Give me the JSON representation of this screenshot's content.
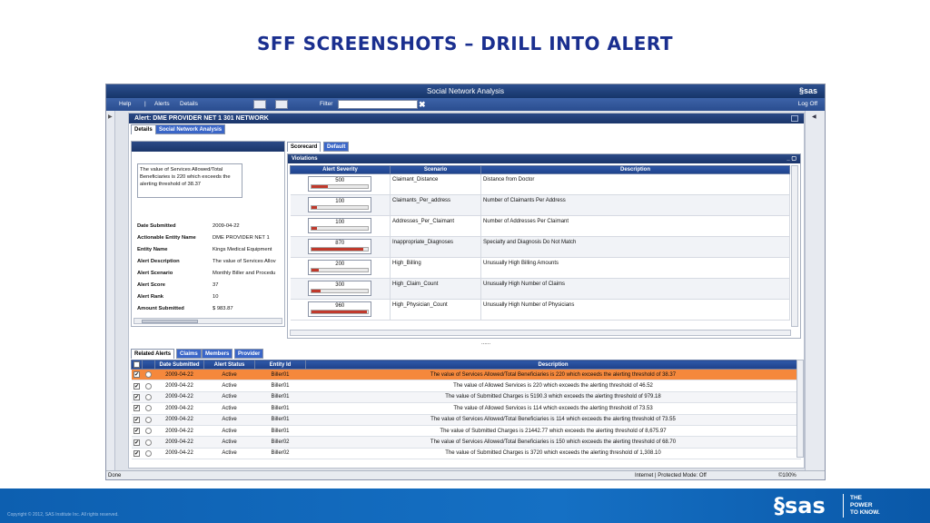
{
  "slide": {
    "title": "SFF SCREENSHOTS – DRILL INTO ALERT"
  },
  "window": {
    "title": "Social Network Analysis",
    "logo": "§sas"
  },
  "menu": {
    "help": "Help",
    "alerts": "Alerts",
    "details": "Details",
    "filter_label": "Filter",
    "filter_value": "",
    "clear": "✖",
    "logoff": "Log Off"
  },
  "alert": {
    "title": "Alert:  DME PROVIDER NET 1 301 NETWORK"
  },
  "tabs": [
    "Details",
    "Social Network Analysis"
  ],
  "details": {
    "description": "The value of Services Allowed/Total Beneficiaries is 220 which exceeds the alerting threshold of 38.37",
    "fields": [
      {
        "k": "Date Submitted",
        "v": "2009-04-22"
      },
      {
        "k": "Actionable Entity Name",
        "v": "DME PROVIDER NET 1"
      },
      {
        "k": "Entity Name",
        "v": "Kings Medical Equipment"
      },
      {
        "k": "Alert Description",
        "v": "The value of Services Allov"
      },
      {
        "k": "Alert Scenario",
        "v": "Monthly Biller and Procedu"
      },
      {
        "k": "Alert Score",
        "v": "37"
      },
      {
        "k": "Alert Rank",
        "v": "10"
      },
      {
        "k": "Amount Submitted",
        "v": "$ 983.87"
      }
    ]
  },
  "scorecard_tabs": [
    "Scorecard",
    "Default"
  ],
  "violations": {
    "title": "Violations",
    "columns": [
      "Alert Severity",
      "Scenario",
      "Description"
    ],
    "rows": [
      {
        "severity": "500",
        "fill": 0.28,
        "scenario": "Claimant_Distance",
        "description": "Distance from Doctor"
      },
      {
        "severity": "100",
        "fill": 0.1,
        "scenario": "Claimants_Per_address",
        "description": "Number of Claimants Per Address"
      },
      {
        "severity": "100",
        "fill": 0.1,
        "scenario": "Addresses_Per_Claimant",
        "description": "Number of Addresses Per Claimant"
      },
      {
        "severity": "870",
        "fill": 0.92,
        "scenario": "Inappropriate_Diagnoses",
        "description": "Specialty and Diagnosis Do Not Match"
      },
      {
        "severity": "200",
        "fill": 0.12,
        "scenario": "High_Billing",
        "description": "Unusually High Billing Amounts"
      },
      {
        "severity": "300",
        "fill": 0.16,
        "scenario": "High_Claim_Count",
        "description": "Unusually High Number of Claims"
      },
      {
        "severity": "960",
        "fill": 0.98,
        "scenario": "High_Physician_Count",
        "description": "Unusually High Number of Physicians"
      }
    ]
  },
  "related_tabs": [
    "Related Alerts",
    "Claims",
    "Members",
    "Provider"
  ],
  "related": {
    "columns": [
      "Date Submitted",
      "Alert Status",
      "Entity Id",
      "Description"
    ],
    "rows": [
      {
        "date": "2009-04-22",
        "status": "Active",
        "entity": "Biller01",
        "desc": "The value of Services Allowed/Total Beneficiaries is 220 which exceeds the alerting threshold of 38.37",
        "selected": true
      },
      {
        "date": "2009-04-22",
        "status": "Active",
        "entity": "Biller01",
        "desc": "The value of Allowed Services is 220 which exceeds the alerting threshold of 46.52",
        "selected": false
      },
      {
        "date": "2009-04-22",
        "status": "Active",
        "entity": "Biller01",
        "desc": "The value of Submitted Charges is 5190.3 which exceeds the alerting threshold of 979.18",
        "selected": false
      },
      {
        "date": "2009-04-22",
        "status": "Active",
        "entity": "Biller01",
        "desc": "The value of Allowed Services is 114 which exceeds the alerting threshold of 73.53",
        "selected": false
      },
      {
        "date": "2009-04-22",
        "status": "Active",
        "entity": "Biller01",
        "desc": "The value of Services Allowed/Total Beneficiaries is 114 which exceeds the alerting threshold of 73.55",
        "selected": false
      },
      {
        "date": "2009-04-22",
        "status": "Active",
        "entity": "Biller01",
        "desc": "The value of Submitted Charges is 21442.77 which exceeds the alerting threshold of 8,675.97",
        "selected": false
      },
      {
        "date": "2009-04-22",
        "status": "Active",
        "entity": "Biller02",
        "desc": "The value of Services Allowed/Total Beneficiaries is 150 which exceeds the alerting threshold of 68.70",
        "selected": false
      },
      {
        "date": "2009-04-22",
        "status": "Active",
        "entity": "Biller02",
        "desc": "The value of Submitted Charges is 3720 which exceeds the alerting threshold of 1,308.10",
        "selected": false
      }
    ]
  },
  "status": {
    "left": "Done",
    "zone": "Internet | Protected Mode: Off",
    "zoom": "©100%"
  },
  "footer": {
    "copyright": "Copyright © 2012, SAS Institute Inc. All rights reserved.",
    "brand": "§sas",
    "tagline": [
      "THE",
      "POWER",
      "TO KNOW."
    ]
  },
  "colors": {
    "title": "#1a2f8f",
    "header": "#1e418a",
    "selected_row": "#f5883c",
    "severity_fill": "#c0392b",
    "footer": "#1570c4"
  }
}
